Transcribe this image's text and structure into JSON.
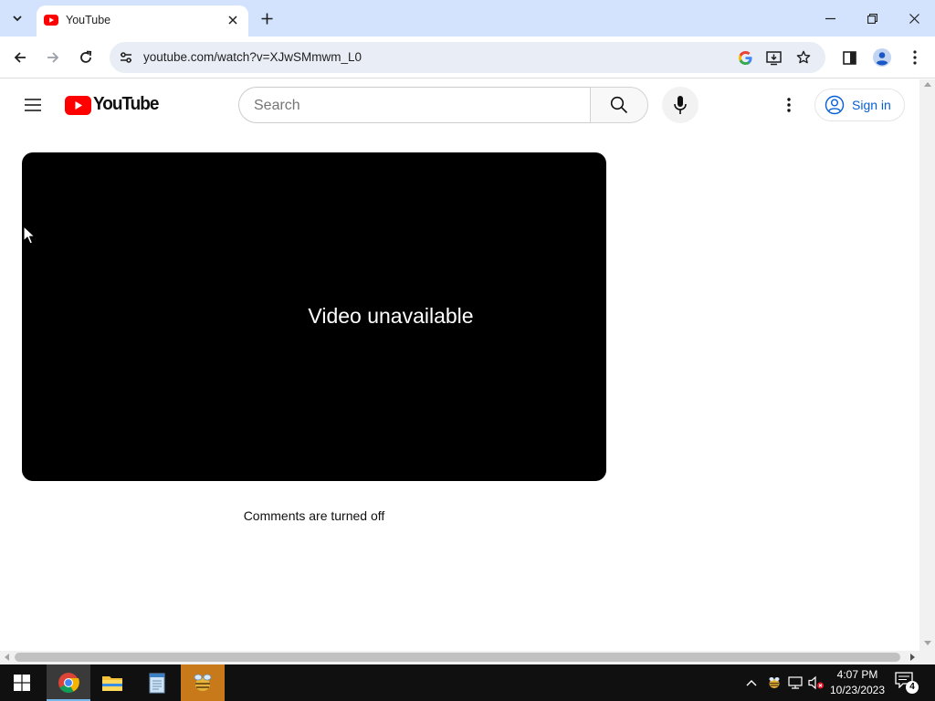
{
  "browser": {
    "tab": {
      "title": "YouTube"
    },
    "url": "youtube.com/watch?v=XJwSMmwm_L0",
    "icons": [
      "tab-search-icon",
      "close-icon",
      "plus-icon",
      "minimize-icon",
      "restore-icon",
      "back-icon",
      "forward-icon",
      "reload-icon",
      "site-info-icon",
      "google-lens-icon",
      "install-app-icon",
      "star-icon",
      "side-panel-icon",
      "profile-icon",
      "menu-dots-icon"
    ]
  },
  "youtube": {
    "logo_text": "YouTube",
    "search_placeholder": "Search",
    "sign_in_label": "Sign in",
    "player_message": "Video unavailable",
    "comments_message": "Comments are turned off",
    "colors": {
      "brand_red": "#ff0000",
      "link_blue": "#065fd4"
    }
  },
  "taskbar": {
    "apps": [
      "windows-start-icon",
      "chrome-icon",
      "file-explorer-icon",
      "notepad-icon",
      "app-icon"
    ],
    "clock_time": "4:07 PM",
    "clock_date": "10/23/2023",
    "notification_count": "4"
  }
}
